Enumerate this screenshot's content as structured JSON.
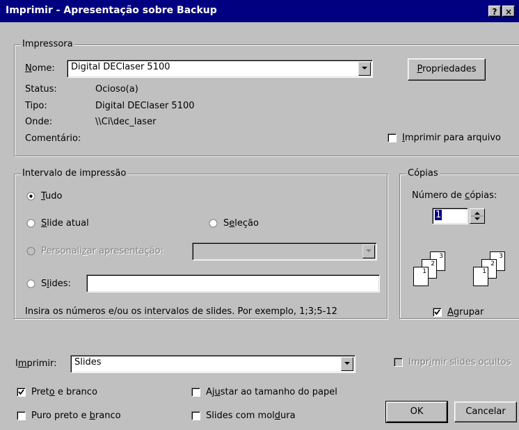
{
  "window": {
    "title": "Imprimir - Apresentação sobre Backup",
    "help_button": "?",
    "close_button": "×"
  },
  "printer": {
    "legend": "Impressora",
    "name_label_prefix": "N",
    "name_label_rest": "ome:",
    "name_value": "Digital DEClaser 5100",
    "properties_button_prefix": "P",
    "properties_button_rest": "ropriedades",
    "status_label": "Status:",
    "status_value": "Ocioso(a)",
    "type_label": "Tipo:",
    "type_value": "Digital DEClaser 5100",
    "where_label": "Onde:",
    "where_value": "\\\\Ci\\dec_laser",
    "comment_label": "Comentário:",
    "print_to_file_prefix": "I",
    "print_to_file_rest": "mprimir para arquivo",
    "print_to_file_checked": false
  },
  "range": {
    "legend": "Intervalo de impressão",
    "all_prefix": "T",
    "all_rest": "udo",
    "current_prefix": "S",
    "current_rest": "lide atual",
    "selection_a": "S",
    "selection_b": "e",
    "selection_c": "leção",
    "custom_a": "Personali",
    "custom_b": "z",
    "custom_c": "ar apresentação:",
    "slides_a": "S",
    "slides_b": "l",
    "slides_c": "ides:",
    "slides_value": "",
    "hint": "Insira os números e/ou os intervalos de slides. Por exemplo, 1;3;5-12",
    "selected": "all"
  },
  "copies": {
    "legend": "Cópias",
    "count_label_a": "Número de ",
    "count_label_b": "c",
    "count_label_c": "ópias:",
    "count_value": "1",
    "collate_prefix": "A",
    "collate_rest": "grupar",
    "collate_checked": true,
    "page_numbers": [
      "1",
      "2",
      "3"
    ]
  },
  "print_what": {
    "label_a": "I",
    "label_b": "m",
    "label_c": "primir:",
    "value": "Slides",
    "hidden_slides_a": "Impr",
    "hidden_slides_b": "i",
    "hidden_slides_c": "mir slides ocultos",
    "hidden_slides_checked": false
  },
  "options": {
    "bw_a": "Pret",
    "bw_b": "o",
    "bw_c": " e branco",
    "bw_checked": true,
    "fit_a": "Aj",
    "fit_b": "u",
    "fit_c": "star ao tamanho do papel",
    "fit_checked": false,
    "pure_bw_a": "Puro preto e ",
    "pure_bw_b": "b",
    "pure_bw_c": "ranco",
    "pure_bw_checked": false,
    "frame_a": "Slides com mol",
    "frame_b": "d",
    "frame_c": "ura",
    "frame_checked": false
  },
  "buttons": {
    "ok": "OK",
    "cancel": "Cancelar"
  }
}
